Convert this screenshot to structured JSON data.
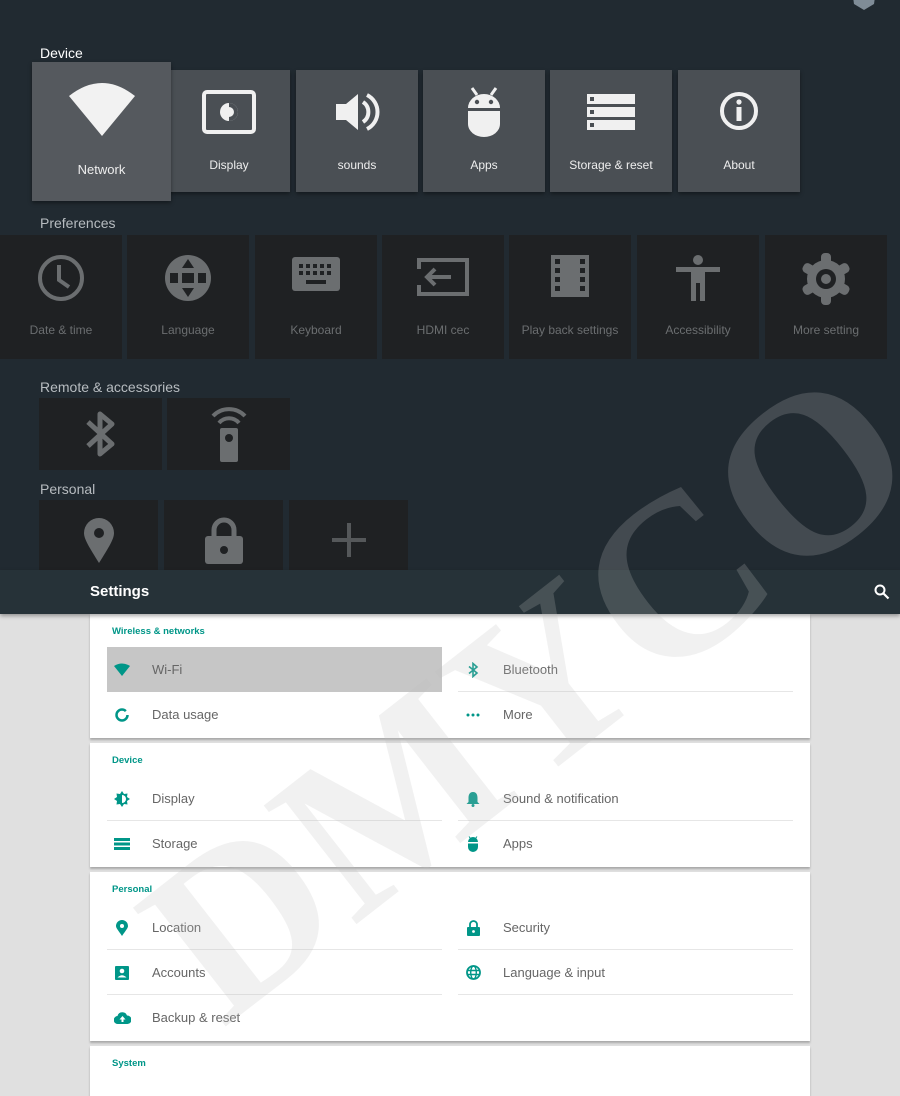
{
  "tv_settings": {
    "sections": {
      "device": "Device",
      "preferences": "Preferences",
      "remote": "Remote & accessories",
      "personal": "Personal"
    },
    "device_tiles": [
      {
        "label": "Network",
        "icon": "wifi-icon",
        "focused": true
      },
      {
        "label": "Display",
        "icon": "display-brightness-icon"
      },
      {
        "label": "sounds",
        "icon": "volume-icon"
      },
      {
        "label": "Apps",
        "icon": "android-icon"
      },
      {
        "label": "Storage & reset",
        "icon": "storage-icon"
      },
      {
        "label": "About",
        "icon": "info-icon"
      }
    ],
    "preference_tiles": [
      {
        "label": "Date & time",
        "icon": "clock-icon"
      },
      {
        "label": "Language",
        "icon": "globe-icon"
      },
      {
        "label": "Keyboard",
        "icon": "keyboard-icon"
      },
      {
        "label": "HDMI cec",
        "icon": "input-icon"
      },
      {
        "label": "Play back settings",
        "icon": "film-icon"
      },
      {
        "label": "Accessibility",
        "icon": "accessibility-icon"
      },
      {
        "label": "More setting",
        "icon": "gear-icon"
      }
    ],
    "remote_tiles": [
      {
        "icon": "bluetooth-icon"
      },
      {
        "icon": "remote-control-icon"
      }
    ],
    "personal_tiles": [
      {
        "icon": "location-pin-icon"
      },
      {
        "icon": "lock-icon"
      },
      {
        "icon": "plus-icon"
      }
    ]
  },
  "android_settings": {
    "title": "Settings",
    "search_icon": "search-icon",
    "accent_color": "#009688",
    "categories": [
      {
        "title": "Wireless & networks",
        "items": [
          {
            "label": "Wi-Fi",
            "icon": "wifi-icon",
            "selected": true
          },
          {
            "label": "Bluetooth",
            "icon": "bluetooth-icon"
          },
          {
            "label": "Data usage",
            "icon": "data-usage-icon"
          },
          {
            "label": "More",
            "icon": "more-dots-icon"
          }
        ]
      },
      {
        "title": "Device",
        "items": [
          {
            "label": "Display",
            "icon": "brightness-icon"
          },
          {
            "label": "Sound & notification",
            "icon": "bell-icon"
          },
          {
            "label": "Storage",
            "icon": "storage-icon"
          },
          {
            "label": "Apps",
            "icon": "android-icon"
          }
        ]
      },
      {
        "title": "Personal",
        "items": [
          {
            "label": "Location",
            "icon": "location-pin-icon"
          },
          {
            "label": "Security",
            "icon": "lock-icon"
          },
          {
            "label": "Accounts",
            "icon": "account-box-icon"
          },
          {
            "label": "Language & input",
            "icon": "globe-icon"
          },
          {
            "label": "Backup & reset",
            "icon": "cloud-upload-icon"
          }
        ]
      },
      {
        "title": "System",
        "items": []
      }
    ]
  },
  "watermark": "DMYCO"
}
